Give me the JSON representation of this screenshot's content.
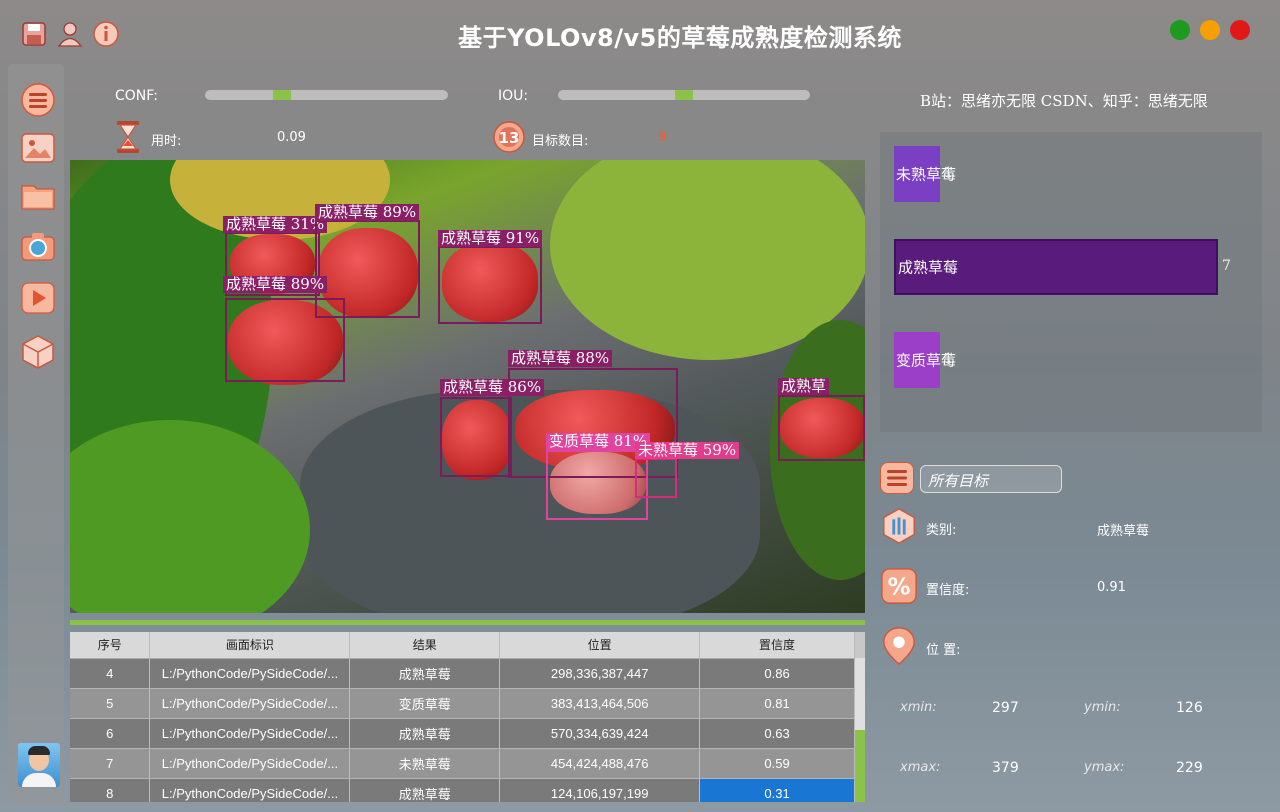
{
  "app": {
    "title": "基于YOLOv8/v5的草莓成熟度检测系统",
    "credit": "B站：思绪亦无限  CSDN、知乎：思绪无限"
  },
  "toolbar": {
    "icons": [
      "save-icon",
      "user-icon",
      "info-icon"
    ]
  },
  "window_controls": {
    "colors": [
      "#1e9a1e",
      "#f5a000",
      "#e01818"
    ]
  },
  "sidebar": {
    "items": [
      "menu-icon",
      "image-icon",
      "folder-icon",
      "camera-icon",
      "video-icon",
      "model-icon"
    ]
  },
  "controls": {
    "conf_label": "CONF:",
    "conf_value": 0.3,
    "iou_label": "IOU:",
    "iou_value": 0.5,
    "time_label": "用时:",
    "time_value": "0.09",
    "count_label": "目标数目:",
    "count_value": "9"
  },
  "detections": [
    {
      "label": "成熟草莓 31%"
    },
    {
      "label": "成熟草莓 89%"
    },
    {
      "label": "成熟草莓 91%"
    },
    {
      "label": "成熟草莓 89%"
    },
    {
      "label": "成熟草莓 88%"
    },
    {
      "label": "成熟草莓 86%"
    },
    {
      "label": "成熟草"
    },
    {
      "label": "变质草莓 81%"
    },
    {
      "label": "未熟草莓 59%"
    }
  ],
  "table": {
    "headers": [
      "序号",
      "画面标识",
      "结果",
      "位置",
      "置信度"
    ],
    "rows": [
      {
        "idx": "4",
        "path": "L:/PythonCode/PySideCode/...",
        "result": "成熟草莓",
        "pos": "298,336,387,447",
        "conf": "0.86"
      },
      {
        "idx": "5",
        "path": "L:/PythonCode/PySideCode/...",
        "result": "变质草莓",
        "pos": "383,413,464,506",
        "conf": "0.81"
      },
      {
        "idx": "6",
        "path": "L:/PythonCode/PySideCode/...",
        "result": "成熟草莓",
        "pos": "570,334,639,424",
        "conf": "0.63"
      },
      {
        "idx": "7",
        "path": "L:/PythonCode/PySideCode/...",
        "result": "未熟草莓",
        "pos": "454,424,488,476",
        "conf": "0.59"
      },
      {
        "idx": "8",
        "path": "L:/PythonCode/PySideCode/...",
        "result": "成熟草莓",
        "pos": "124,106,197,199",
        "conf": "0.31"
      }
    ]
  },
  "chart_data": {
    "type": "bar",
    "orientation": "horizontal",
    "categories": [
      "未熟草莓",
      "成熟草莓",
      "变质草莓"
    ],
    "values": [
      1,
      7,
      1
    ],
    "colors": [
      "#7b3fc4",
      "#5a1c7c",
      "#9b3fc8"
    ]
  },
  "filter": {
    "placeholder": "所有目标"
  },
  "details": {
    "class_label": "类别:",
    "class_value": "成熟草莓",
    "conf_label": "置信度:",
    "conf_value": "0.91",
    "pos_label": "位 置:",
    "xmin_label": "xmin:",
    "xmin": "297",
    "ymin_label": "ymin:",
    "ymin": "126",
    "xmax_label": "xmax:",
    "xmax": "379",
    "ymax_label": "ymax:",
    "ymax": "229"
  }
}
